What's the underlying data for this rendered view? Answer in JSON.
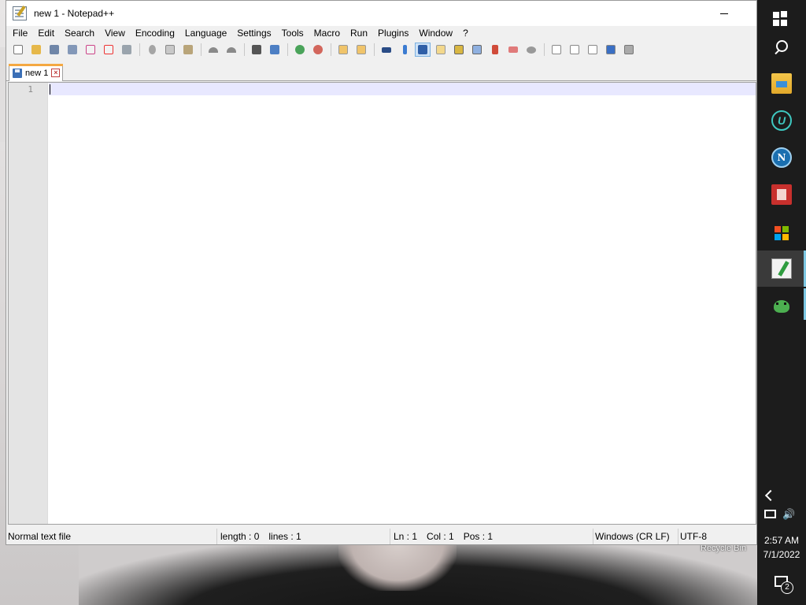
{
  "window": {
    "title": "new 1 - Notepad++"
  },
  "menu": [
    "File",
    "Edit",
    "Search",
    "View",
    "Encoding",
    "Language",
    "Settings",
    "Tools",
    "Macro",
    "Run",
    "Plugins",
    "Window",
    "?"
  ],
  "toolbar": {
    "buttons": [
      "new-file",
      "open-file",
      "save",
      "save-all",
      "close",
      "close-all",
      "print",
      "cut",
      "copy",
      "paste",
      "undo",
      "redo",
      "find",
      "replace",
      "zoom-in",
      "zoom-out",
      "sync-vertical",
      "sync-horizontal",
      "word-wrap",
      "show-all-chars",
      "indent-guide",
      "user-defined-lang",
      "doc-map",
      "function-list",
      "folder-as-workspace",
      "monitoring",
      "record-macro",
      "stop-macro",
      "play-macro",
      "run-macro-multiple",
      "save-macro"
    ]
  },
  "tab": {
    "label": "new 1"
  },
  "editor": {
    "line_number": "1"
  },
  "status": {
    "file_type": "Normal text file",
    "length": "length : 0",
    "lines": "lines : 1",
    "ln": "Ln : 1",
    "col": "Col : 1",
    "pos": "Pos : 1",
    "eol": "Windows (CR LF)",
    "encoding": "UTF-8"
  },
  "desktop": {
    "recycle_bin_label": "Recycle Bin"
  },
  "taskbar": {
    "time": "2:57 AM",
    "date": "7/1/2022",
    "notification_count": "2"
  },
  "colors": {
    "toolbar_active": "#cfe3f7",
    "tab_accent": "#f4a842",
    "current_line": "#e8e8ff",
    "taskbar_bg": "#1c1c1c",
    "taskbar_active": "#7ec8e3"
  }
}
